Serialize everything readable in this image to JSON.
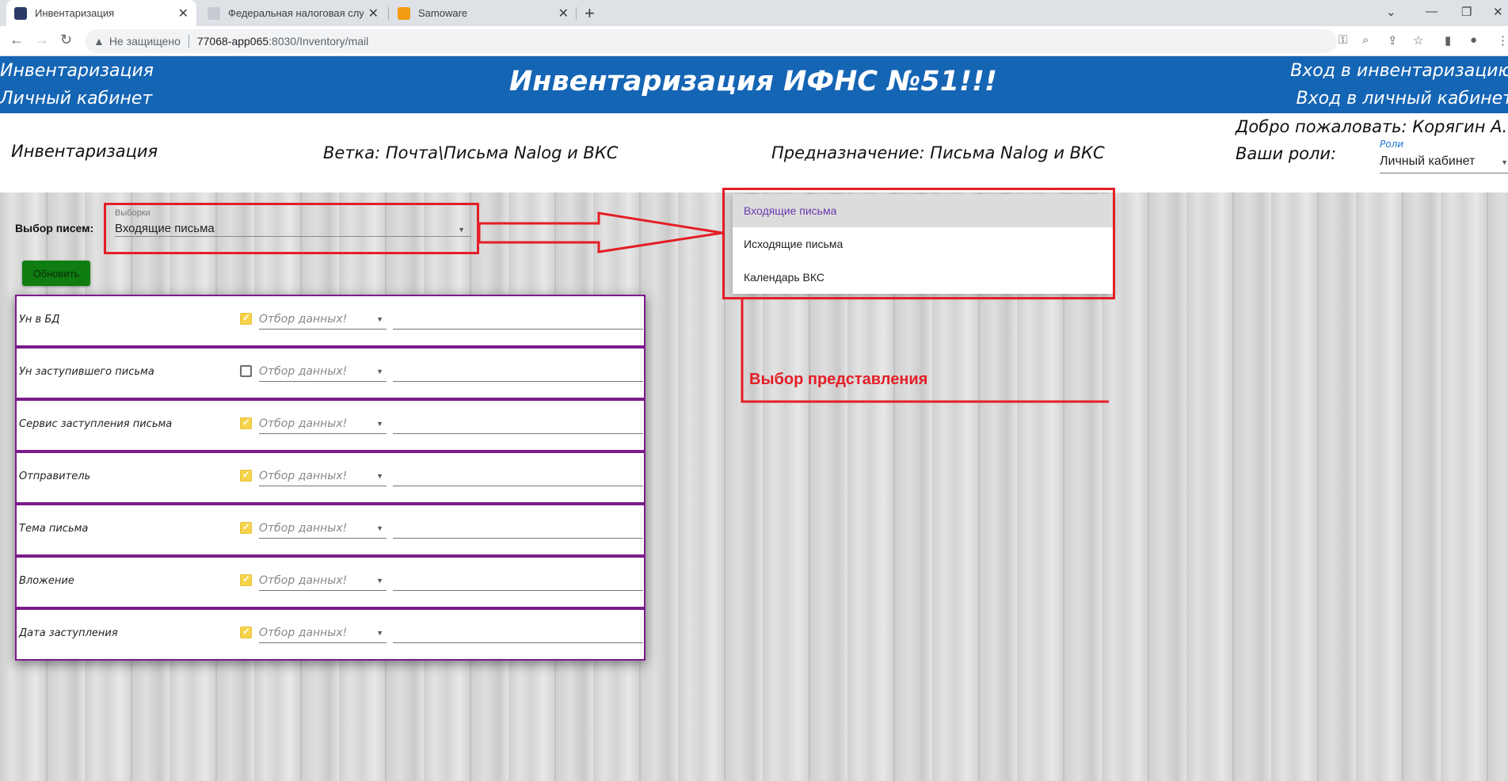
{
  "browser": {
    "tabs": [
      {
        "label": "Инвентаризация",
        "active": true
      },
      {
        "label": "Федеральная налоговая служба",
        "active": false
      },
      {
        "label": "Samoware",
        "active": false
      }
    ],
    "new_tab": "+",
    "security_label": "Не защищено",
    "url_host": "77068-app065",
    "url_path": ":8030/Inventory/mail"
  },
  "header": {
    "left_links": [
      "Инвентаризация",
      "Личный кабинет"
    ],
    "title": "Инвентаризация ИФНС №51!!!",
    "right_links": [
      "Вход в инвентаризацию",
      "Вход в личный кабинет"
    ]
  },
  "subheader": {
    "section": "Инвентаризация",
    "branch": "Ветка: Почта\\Письма Nalog и ВКС",
    "purpose": "Предназначение: Письма Nalog и ВКС",
    "welcome": "Добро пожаловать: Корягин А.С.",
    "roles_prefix": "Ваши роли:",
    "roles_float_label": "Роли",
    "roles_value": "Личный кабинет"
  },
  "form": {
    "pick_label": "Выбор писем:",
    "select_float_label": "Выборки",
    "select_value": "Входящие письма",
    "refresh_label": "Обновить"
  },
  "filters": {
    "placeholder": "Отбор данных!",
    "rows": [
      {
        "name": "Ун в БД",
        "checked": true
      },
      {
        "name": "Ун заступившего письма",
        "checked": false
      },
      {
        "name": "Сервис заступления письма",
        "checked": true
      },
      {
        "name": "Отправитель",
        "checked": true
      },
      {
        "name": "Тема письма",
        "checked": true
      },
      {
        "name": "Вложение",
        "checked": true
      },
      {
        "name": "Дата заступления",
        "checked": true
      }
    ]
  },
  "dropdown": {
    "options": [
      "Входящие письма",
      "Исходящие письма",
      "Календарь ВКС"
    ],
    "selected_index": 0
  },
  "annotation": {
    "caption": "Выбор представления",
    "color": "#e41e26"
  },
  "colors": {
    "banner": "#1565b5",
    "refresh_button": "#0f7d12",
    "row_border": "#7a1b8a",
    "checkbox_on": "#f6d34a"
  }
}
